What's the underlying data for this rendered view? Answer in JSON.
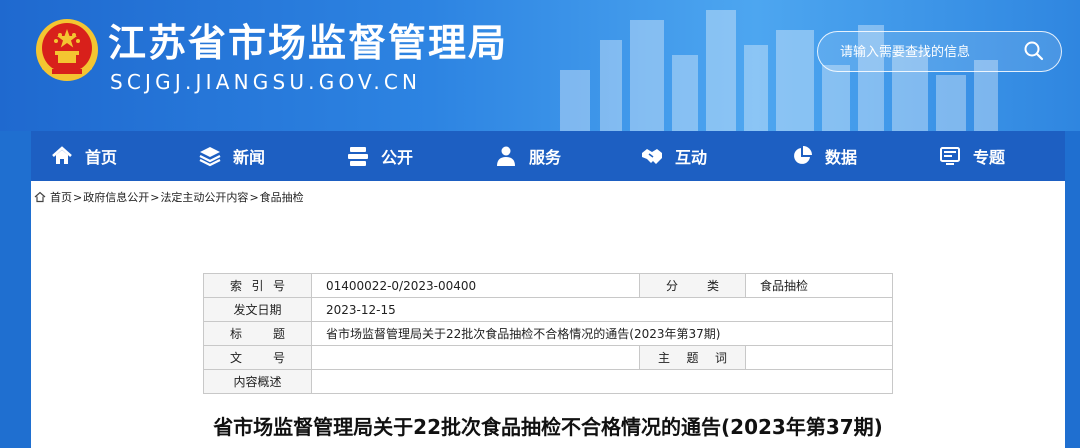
{
  "header": {
    "title": "江苏省市场监督管理局",
    "domain": "SCJGJ.JIANGSU.GOV.CN",
    "search_placeholder": "请输入需要查找的信息"
  },
  "nav": {
    "items": [
      {
        "label": "首页",
        "icon": "home-icon"
      },
      {
        "label": "新闻",
        "icon": "layers-icon"
      },
      {
        "label": "公开",
        "icon": "stack-icon"
      },
      {
        "label": "服务",
        "icon": "people-icon"
      },
      {
        "label": "互动",
        "icon": "handshake-icon"
      },
      {
        "label": "数据",
        "icon": "pie-chart-icon"
      },
      {
        "label": "专题",
        "icon": "monitor-icon"
      }
    ]
  },
  "breadcrumb": {
    "items": [
      "首页",
      "政府信息公开",
      "法定主动公开内容",
      "食品抽检"
    ],
    "separator": ">"
  },
  "meta": {
    "index_label": "索引号",
    "index_value": "01400022-0/2023-00400",
    "category_label": "分类",
    "category_value": "食品抽检",
    "date_label": "发文日期",
    "date_value": "2023-12-15",
    "title_label": "标题",
    "title_value": "省市场监督管理局关于22批次食品抽检不合格情况的通告(2023年第37期)",
    "docno_label": "文号",
    "docno_value": "",
    "keywords_label": "主题词",
    "keywords_value": "",
    "summary_label": "内容概述",
    "summary_value": ""
  },
  "document": {
    "title": "省市场监督管理局关于22批次食品抽检不合格情况的通告(2023年第37期)"
  },
  "colors": {
    "header_blue": "#2d84e2",
    "nav_blue": "#1d5fc2",
    "emblem_red": "#d8201b",
    "emblem_gold": "#f4c531"
  }
}
